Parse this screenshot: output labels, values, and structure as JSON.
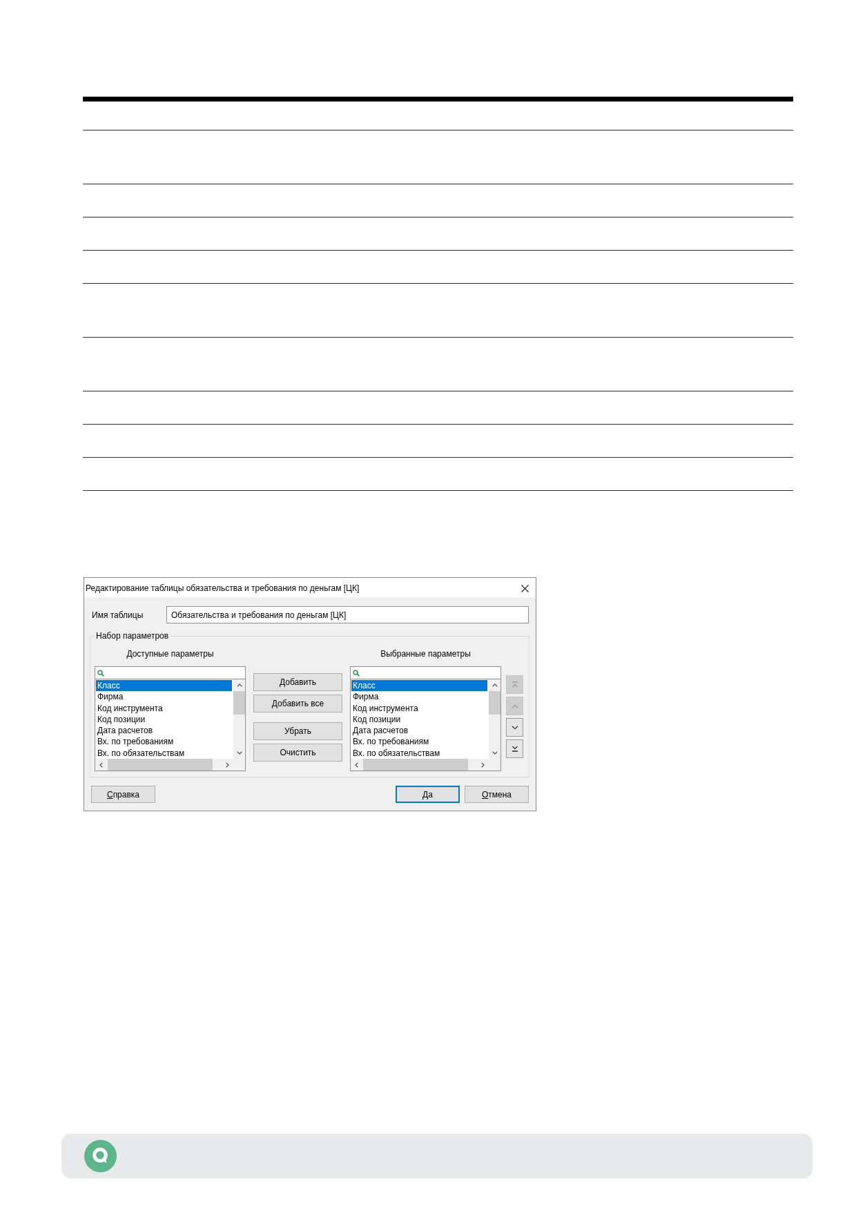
{
  "window": {
    "title": "Редактирование таблицы обязательства и требования по деньгам [ЦК]"
  },
  "table_name": {
    "label": "Имя таблицы",
    "value": "Обязательства и требования по деньгам [ЦК]"
  },
  "parameter_set": {
    "legend": "Набор параметров",
    "lists": [
      {
        "heading": "Доступные параметры",
        "items": [
          {
            "label": "Класс",
            "selected": true
          },
          {
            "label": "Фирма",
            "selected": false
          },
          {
            "label": "Код инструмента",
            "selected": false
          },
          {
            "label": "Код позиции",
            "selected": false
          },
          {
            "label": "Дата расчетов",
            "selected": false
          },
          {
            "label": "Вх. по требованиям",
            "selected": false
          },
          {
            "label": "Вх. по обязательствам",
            "selected": false
          }
        ]
      },
      {
        "heading": "Выбранные параметры",
        "items": [
          {
            "label": "Класс",
            "selected": true
          },
          {
            "label": "Фирма",
            "selected": false
          },
          {
            "label": "Код инструмента",
            "selected": false
          },
          {
            "label": "Код позиции",
            "selected": false
          },
          {
            "label": "Дата расчетов",
            "selected": false
          },
          {
            "label": "Вх. по требованиям",
            "selected": false
          },
          {
            "label": "Вх. по обязательствам",
            "selected": false
          }
        ]
      }
    ],
    "transfer_groups": [
      {
        "buttons": [
          {
            "label": "Добавить"
          },
          {
            "label": "Добавить все"
          }
        ]
      },
      {
        "buttons": [
          {
            "label": "Убрать"
          },
          {
            "label": "Очистить"
          }
        ]
      }
    ],
    "order_buttons": [
      {
        "kind": "top",
        "disabled": true
      },
      {
        "kind": "up",
        "disabled": true
      },
      {
        "kind": "down",
        "disabled": false
      },
      {
        "kind": "bottom",
        "disabled": false
      }
    ]
  },
  "footer": {
    "left": [
      {
        "label": "Справка",
        "mnemonic": true,
        "default": false
      }
    ],
    "right": [
      {
        "label": "Да",
        "mnemonic": true,
        "default": true
      },
      {
        "label": "Отмена",
        "mnemonic": true,
        "default": false
      }
    ]
  }
}
